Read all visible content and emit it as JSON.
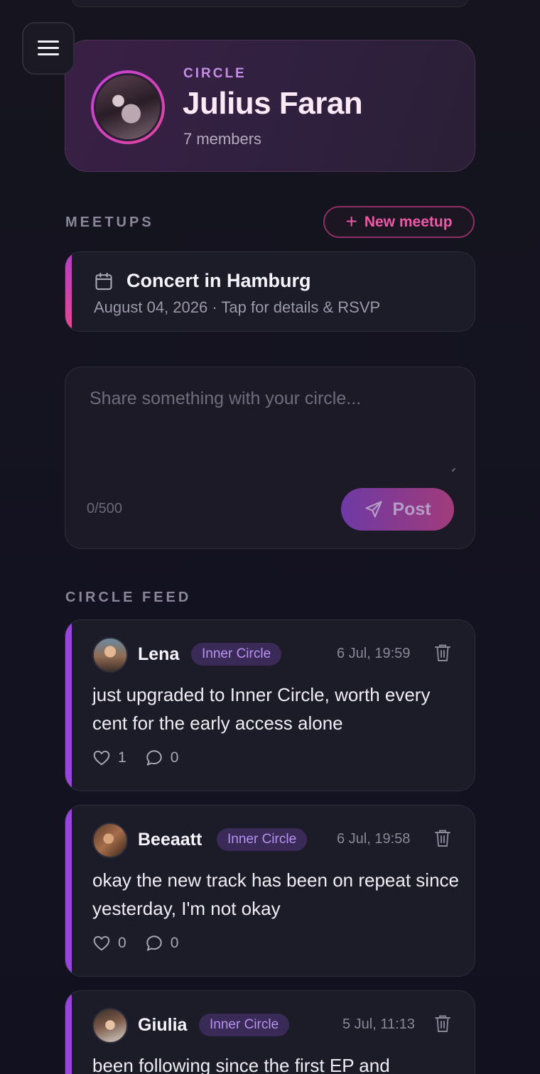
{
  "hero": {
    "label": "CIRCLE",
    "name": "Julius Faran",
    "members": "7 members"
  },
  "meetups": {
    "section_label": "MEETUPS",
    "new_button": "New meetup",
    "new_button_icon": "plus-icon",
    "items": [
      {
        "title": "Concert in Hamburg",
        "subtitle": "August 04, 2026 · Tap for details & RSVP",
        "icon": "calendar-icon"
      }
    ]
  },
  "composer": {
    "placeholder": "Share something with your circle...",
    "char_count": "0/500",
    "post_label": "Post",
    "post_icon": "send-icon"
  },
  "feed": {
    "section_label": "CIRCLE FEED",
    "posts": [
      {
        "author": "Lena",
        "badge": "Inner Circle",
        "time": "6 Jul, 19:59",
        "text": "just upgraded to Inner Circle, worth every cent for the early access alone",
        "likes": "1",
        "comments": "0"
      },
      {
        "author": "Beeaatt",
        "badge": "Inner Circle",
        "time": "6 Jul, 19:58",
        "text": "okay the new track has been on repeat since yesterday, I'm not okay",
        "likes": "0",
        "comments": "0"
      },
      {
        "author": "Giulia",
        "badge": "Inner Circle",
        "time": "5 Jul, 11:13",
        "text": "been following since the first EP and",
        "likes": "",
        "comments": ""
      }
    ]
  },
  "colors": {
    "accent_pink": "#ec5aa6",
    "accent_purple": "#9a44e0",
    "badge_text": "#b792ef",
    "background": "#14131f"
  }
}
